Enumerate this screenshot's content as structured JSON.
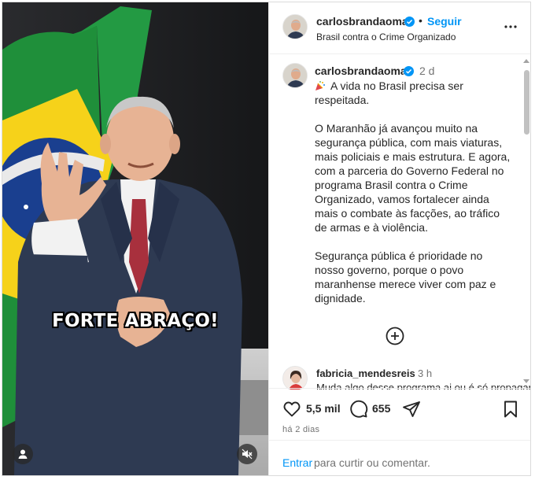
{
  "media": {
    "overlay_text": "FORTE ABRAÇO!",
    "user_icon": "user-tag-icon",
    "mute_icon": "speaker-muted-icon"
  },
  "header": {
    "username": "carlosbrandaoma",
    "separator": "•",
    "follow_label": "Seguir",
    "subtitle": "Brasil contra o Crime Organizado",
    "more_icon": "more-options-icon"
  },
  "caption": {
    "username": "carlosbrandaoma",
    "time": "2 d",
    "text": "A vida no Brasil precisa ser respeitada.\n\nO Maranhão já avançou muito na segurança pública, com mais viaturas, mais policiais e mais estrutura. E agora, com a parceria do Governo Federal no programa Brasil contra o Crime Organizado, vamos fortalecer ainda mais o combate às facções, ao tráfico de armas e à violência.\n\nSegurança pública é prioridade no nosso governo, porque o povo maranhense merece viver com paz e dignidade."
  },
  "comment": {
    "username": "fabricia_mendesreis",
    "time": "3 h",
    "text": "Muda algo desse programa ai ou é só propaganda"
  },
  "actions": {
    "likes": "5,5 mil",
    "comments": "655",
    "posted": "há 2 dias"
  },
  "footer": {
    "login_link": "Entrar",
    "login_text": "para curtir ou comentar."
  },
  "colors": {
    "link": "#0095f6",
    "verified": "#0095f6",
    "muted_text": "#737373"
  }
}
